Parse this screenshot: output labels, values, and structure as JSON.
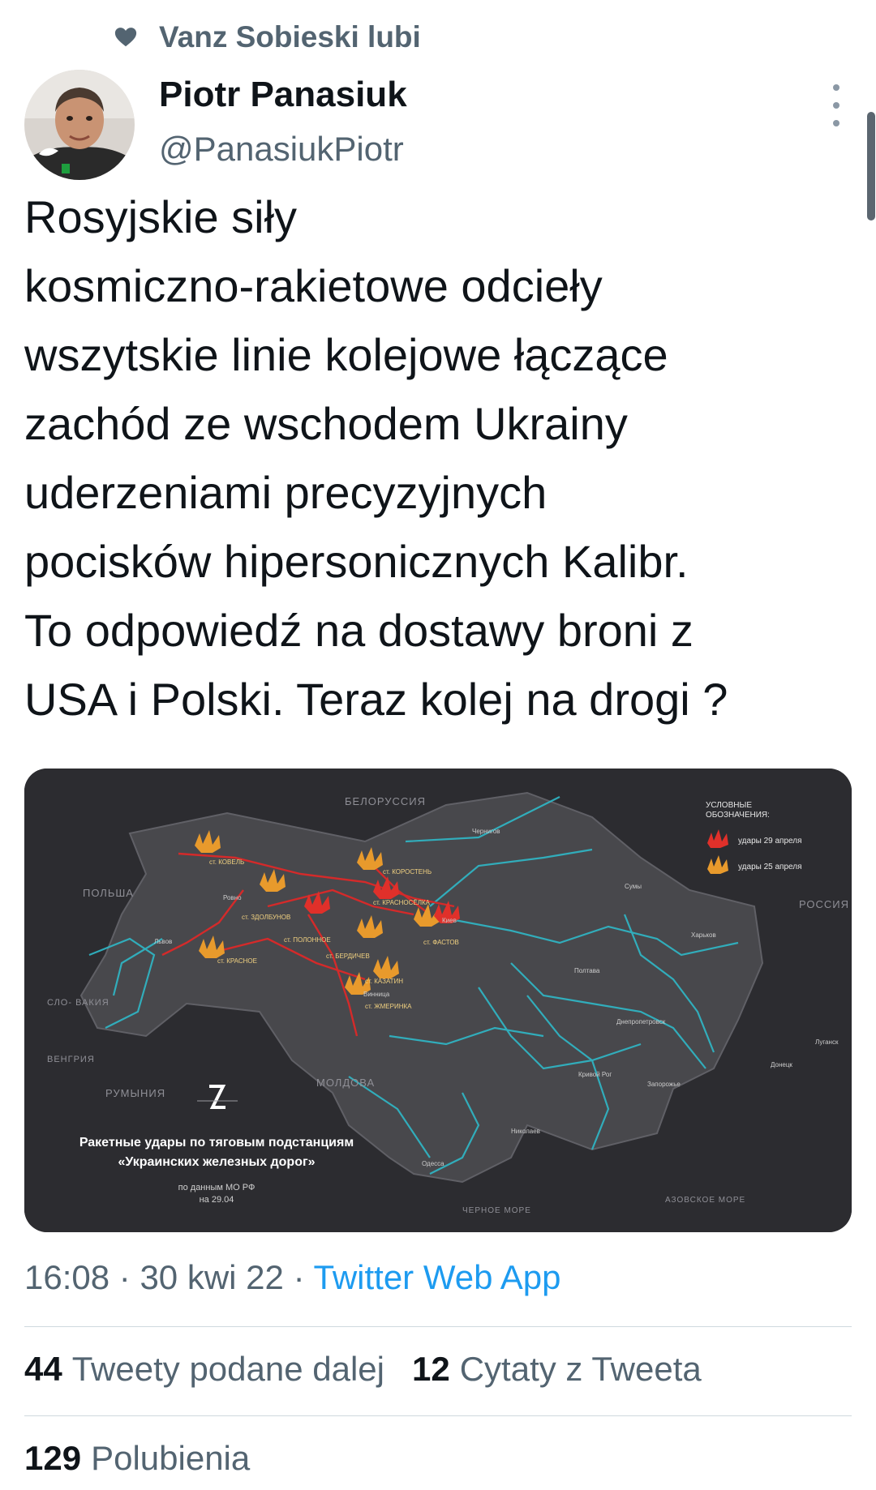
{
  "social_context": {
    "liked_by_text": "Vanz Sobieski lubi"
  },
  "author": {
    "name": "Piotr Panasiuk",
    "handle": "@PanasiukPiotr"
  },
  "tweet": {
    "lines": [
      "Rosyjskie siły",
      "kosmiczno-rakietowe odcieły",
      "wszytskie linie kolejowe łączące",
      "zachód ze wschodem Ukrainy",
      "uderzeniami precyzyjnych",
      "pocisków hipersonicznych Kalibr.",
      "To odpowiedź na dostawy broni z",
      "USA i Polski. Teraz kolej na drogi ?"
    ]
  },
  "media_image": {
    "countries": {
      "belarus": "БЕЛОРУССИЯ",
      "poland": "ПОЛЬША",
      "russia": "РОССИЯ",
      "slovakia": "СЛО-\nВАКИЯ",
      "hungary": "ВЕНГРИЯ",
      "romania": "РУМЫНИЯ",
      "moldova": "МОЛДОВА",
      "black_sea": "ЧЕРНОЕ МОРЕ",
      "azov_sea": "АЗОВСКОЕ МОРЕ"
    },
    "legend": {
      "title_1": "УСЛОВНЫЕ",
      "title_2": "ОБОЗНАЧЕНИЯ:",
      "item_red": "удары 29 апреля",
      "item_orange": "удары 25 апреля"
    },
    "caption_1": "Ракетные удары по тяговым подстанциям",
    "caption_2": "«Украинских железных дорог»",
    "source_1": "по данным МО РФ",
    "source_2": "на 29.04",
    "cities": {
      "kovel": "ст. КОВЕЛЬ",
      "rovno": "Ровно",
      "zdolbunov": "ст. ЗДОЛБУНОВ",
      "lvov": "Львов",
      "krasnoe": "ст. КРАСНОЕ",
      "polonnoe": "ст. ПОЛОННОЕ",
      "berdichev": "ст. БЕРДИЧЕВ",
      "kazatin": "ст. КАЗАТИН",
      "vinnitsa": "Винница",
      "zhmerinka": "ст. ЖМЕРИНКА",
      "korosten": "ст. КОРОСТЕНЬ",
      "krasnoselka": "ст. КРАСНОСЁЛКА",
      "fastov": "ст. ФАСТОВ",
      "kiev": "Киев",
      "chernigov": "Чернигов",
      "sumy": "Сумы",
      "kharkov": "Харьков",
      "poltava": "Полтава",
      "dnepr": "Днепропетровск",
      "krivoy_rog": "Кривой Рог",
      "zaporozhye": "Запорожье",
      "donetsk": "Донецк",
      "lugansk": "Луганск",
      "nikolaev": "Николаев",
      "odessa": "Одесса"
    }
  },
  "meta": {
    "time": "16:08",
    "separator": "·",
    "date": "30 kwi 22",
    "app": "Twitter Web App"
  },
  "stats": {
    "retweets_count": "44",
    "retweets_label": "Tweety podane dalej",
    "quotes_count": "12",
    "quotes_label": "Cytaty z Tweeta",
    "likes_count": "129",
    "likes_label": "Polubienia"
  },
  "colors": {
    "text": "#0f1419",
    "secondary": "#536471",
    "link": "#1d9bf0",
    "divider": "#cfd9de"
  }
}
